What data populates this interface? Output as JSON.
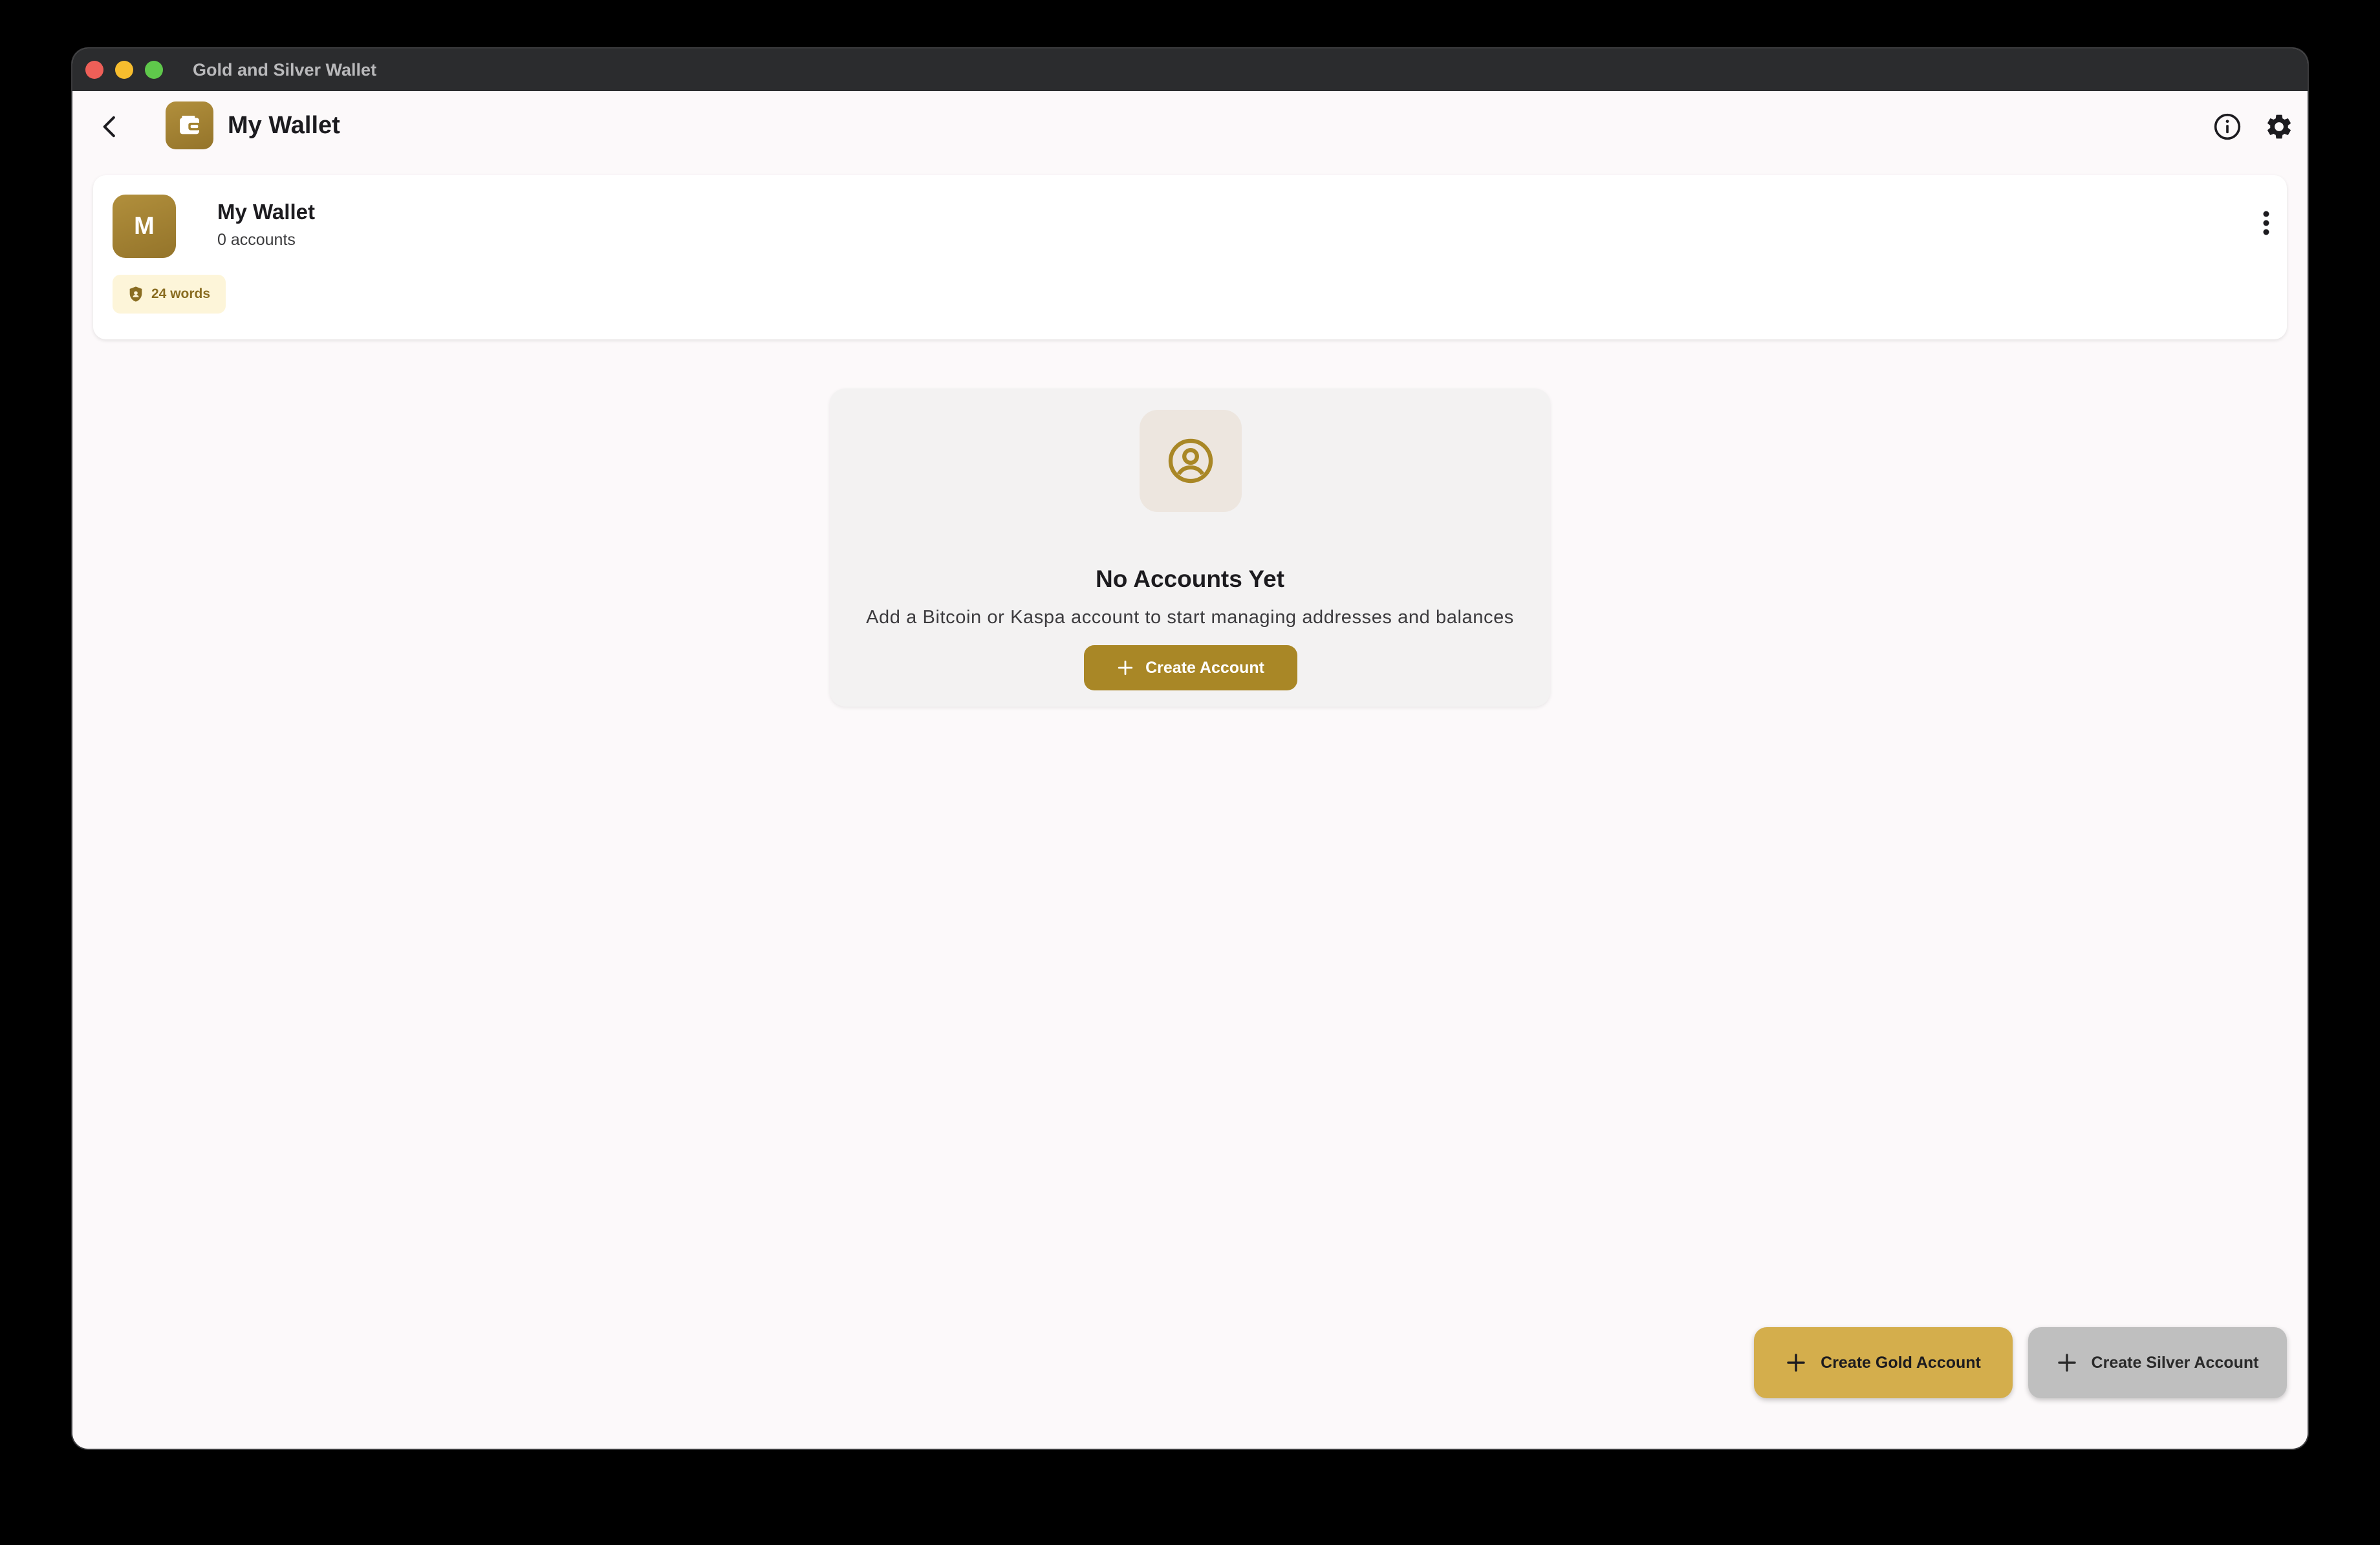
{
  "window": {
    "title": "Gold and Silver Wallet"
  },
  "appbar": {
    "title": "My Wallet"
  },
  "wallet": {
    "avatar_letter": "M",
    "name": "My Wallet",
    "accounts": "0 accounts",
    "words_badge": "24 words"
  },
  "empty_state": {
    "title": "No Accounts Yet",
    "description": "Add a Bitcoin or Kaspa account to start managing addresses and balances",
    "button_label": "Create Account"
  },
  "actions": {
    "gold_label": "Create Gold Account",
    "silver_label": "Create Silver Account"
  },
  "colors": {
    "accent_gold": "#a98726",
    "fab_gold": "#d4ae4c",
    "fab_silver": "#bfbfbf",
    "background": "#fcf9fa"
  }
}
